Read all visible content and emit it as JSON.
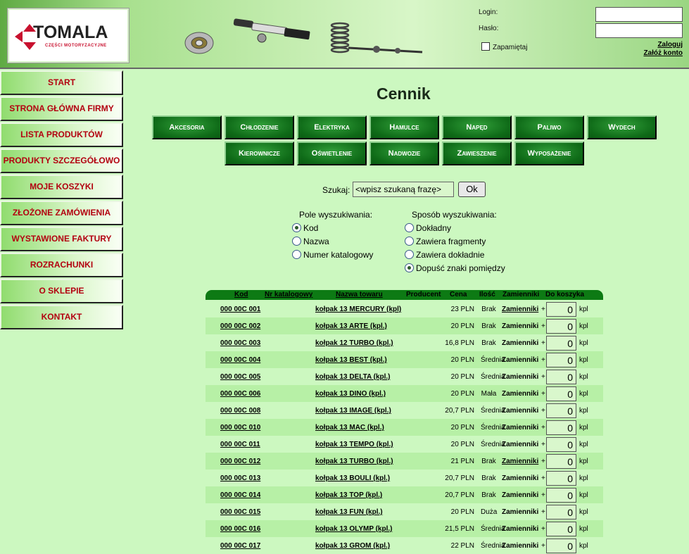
{
  "header": {
    "logo_title": "TOMALA",
    "logo_subtitle": "CZĘŚCI MOTORYZACYJNE",
    "login_label": "Login:",
    "password_label": "Hasło:",
    "login_value": "",
    "password_value": "",
    "remember_label": "Zapamiętaj",
    "login_link": "Zaloguj",
    "register_link": "Załóż konto"
  },
  "sidebar": {
    "items": [
      {
        "label": "START"
      },
      {
        "label": "STRONA GŁÓWNA FIRMY"
      },
      {
        "label": "LISTA PRODUKTÓW"
      },
      {
        "label": "PRODUKTY SZCZEGÓŁOWO"
      },
      {
        "label": "MOJE KOSZYKI"
      },
      {
        "label": "ZŁOŻONE ZAMÓWIENIA"
      },
      {
        "label": "WYSTAWIONE FAKTURY"
      },
      {
        "label": "ROZRACHUNKI"
      },
      {
        "label": "O SKLEPIE"
      },
      {
        "label": "KONTAKT"
      }
    ]
  },
  "main": {
    "title": "Cennik",
    "categories": [
      "Akcesoria",
      "Chłodzenie",
      "Elektryka",
      "Hamulce",
      "Napęd",
      "Paliwo",
      "Wydech",
      "Kierownicze",
      "Oświetlenie",
      "Nadwozie",
      "Zawieszenie",
      "Wyposażenie"
    ],
    "search": {
      "label": "Szukaj:",
      "value": "<wpisz szukaną frazę>",
      "button": "Ok"
    },
    "search_fields": {
      "title": "Pole wyszukiwania:",
      "options": [
        {
          "label": "Kod",
          "selected": true
        },
        {
          "label": "Nazwa",
          "selected": false
        },
        {
          "label": "Numer katalogowy",
          "selected": false
        }
      ]
    },
    "search_mode": {
      "title": "Sposób wyszukiwania:",
      "options": [
        {
          "label": "Dokładny",
          "selected": false
        },
        {
          "label": "Zawiera fragmenty",
          "selected": false
        },
        {
          "label": "Zawiera dokładnie",
          "selected": false
        },
        {
          "label": "Dopuść znaki pomiędzy",
          "selected": true
        }
      ]
    }
  },
  "table": {
    "headers": {
      "kod": "Kod",
      "nr_katalogowy": "Nr katalogowy",
      "nazwa": "Nazwa towaru",
      "producent": "Producent",
      "cena": "Cena",
      "ilosc": "Ilość",
      "zamienniki": "Zamienniki",
      "do_koszyka": "Do koszyka"
    },
    "plus": "+",
    "unit": "kpl",
    "rows": [
      {
        "kod": "000 00C 001",
        "nazwa": "kołpak 13 MERCURY (kpl)",
        "cena": "23 PLN",
        "ilosc": "Brak",
        "zamienniki": "Zamienniki",
        "qty": "0",
        "zam_underline": true
      },
      {
        "kod": "000 00C 002",
        "nazwa": "kołpak 13 ARTE (kpl.)",
        "cena": "20 PLN",
        "ilosc": "Brak",
        "zamienniki": "Zamienniki",
        "qty": "0",
        "zam_underline": false
      },
      {
        "kod": "000 00C 003",
        "nazwa": "kołpak 12 TURBO (kpl.)",
        "cena": "16,8 PLN",
        "ilosc": "Brak",
        "zamienniki": "Zamienniki",
        "qty": "0",
        "zam_underline": false
      },
      {
        "kod": "000 00C 004",
        "nazwa": "kołpak 13 BEST (kpl.)",
        "cena": "20 PLN",
        "ilosc": "Średnia",
        "zamienniki": "Zamienniki",
        "qty": "0",
        "zam_underline": false
      },
      {
        "kod": "000 00C 005",
        "nazwa": "kołpak 13 DELTA (kpl.)",
        "cena": "20 PLN",
        "ilosc": "Średnia",
        "zamienniki": "Zamienniki",
        "qty": "0",
        "zam_underline": false
      },
      {
        "kod": "000 00C 006",
        "nazwa": "kołpak 13 DINO (kpl.)",
        "cena": "20 PLN",
        "ilosc": "Mała",
        "zamienniki": "Zamienniki",
        "qty": "0",
        "zam_underline": false
      },
      {
        "kod": "000 00C 008",
        "nazwa": "kołpak 13 IMAGE (kpl.)",
        "cena": "20,7 PLN",
        "ilosc": "Średnia",
        "zamienniki": "Zamienniki",
        "qty": "0",
        "zam_underline": false
      },
      {
        "kod": "000 00C 010",
        "nazwa": "kołpak 13 MAC (kpl.)",
        "cena": "20 PLN",
        "ilosc": "Średnia",
        "zamienniki": "Zamienniki",
        "qty": "0",
        "zam_underline": false
      },
      {
        "kod": "000 00C 011",
        "nazwa": "kołpak 13 TEMPO (kpl.)",
        "cena": "20 PLN",
        "ilosc": "Średnia",
        "zamienniki": "Zamienniki",
        "qty": "0",
        "zam_underline": false
      },
      {
        "kod": "000 00C 012",
        "nazwa": "kołpak 13 TURBO (kpl.)",
        "cena": "21 PLN",
        "ilosc": "Brak",
        "zamienniki": "Zamienniki",
        "qty": "0",
        "zam_underline": true
      },
      {
        "kod": "000 00C 013",
        "nazwa": "kołpak 13 BOULI (kpl.)",
        "cena": "20,7 PLN",
        "ilosc": "Brak",
        "zamienniki": "Zamienniki",
        "qty": "0",
        "zam_underline": false
      },
      {
        "kod": "000 00C 014",
        "nazwa": "kołpak 13 TOP (kpl.)",
        "cena": "20,7 PLN",
        "ilosc": "Brak",
        "zamienniki": "Zamienniki",
        "qty": "0",
        "zam_underline": false
      },
      {
        "kod": "000 00C 015",
        "nazwa": "kołpak 13 FUN (kpl.)",
        "cena": "20 PLN",
        "ilosc": "Duża",
        "zamienniki": "Zamienniki",
        "qty": "0",
        "zam_underline": false
      },
      {
        "kod": "000 00C 016",
        "nazwa": "kołpak 13 OLYMP (kpl.)",
        "cena": "21,5 PLN",
        "ilosc": "Średnia",
        "zamienniki": "Zamienniki",
        "qty": "0",
        "zam_underline": false
      },
      {
        "kod": "000 00C 017",
        "nazwa": "kołpak 13 GROM (kpl.)",
        "cena": "22 PLN",
        "ilosc": "Średnia",
        "zamienniki": "Zamienniki",
        "qty": "0",
        "zam_underline": false
      }
    ]
  }
}
